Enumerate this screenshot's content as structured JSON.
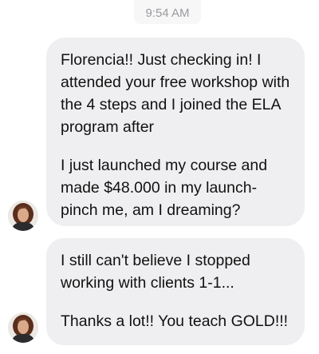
{
  "timestamp": "9:54 AM",
  "messages": [
    {
      "paragraphs": [
        "Florencia!! Just checking in! I attended your free workshop with the 4 steps and I joined the ELA program after",
        "I just launched my course and made $48.000 in my launch- pinch me, am I dreaming?"
      ]
    },
    {
      "paragraphs": [
        "I still can't believe I stopped working with clients 1-1...",
        "Thanks a lot!! You teach GOLD!!!"
      ]
    }
  ],
  "avatar_icon": "profile-photo-woman-icon",
  "colors": {
    "bubble_bg": "#efeff1",
    "bubble_text": "#111111",
    "timestamp_text": "#9a9a9d"
  }
}
